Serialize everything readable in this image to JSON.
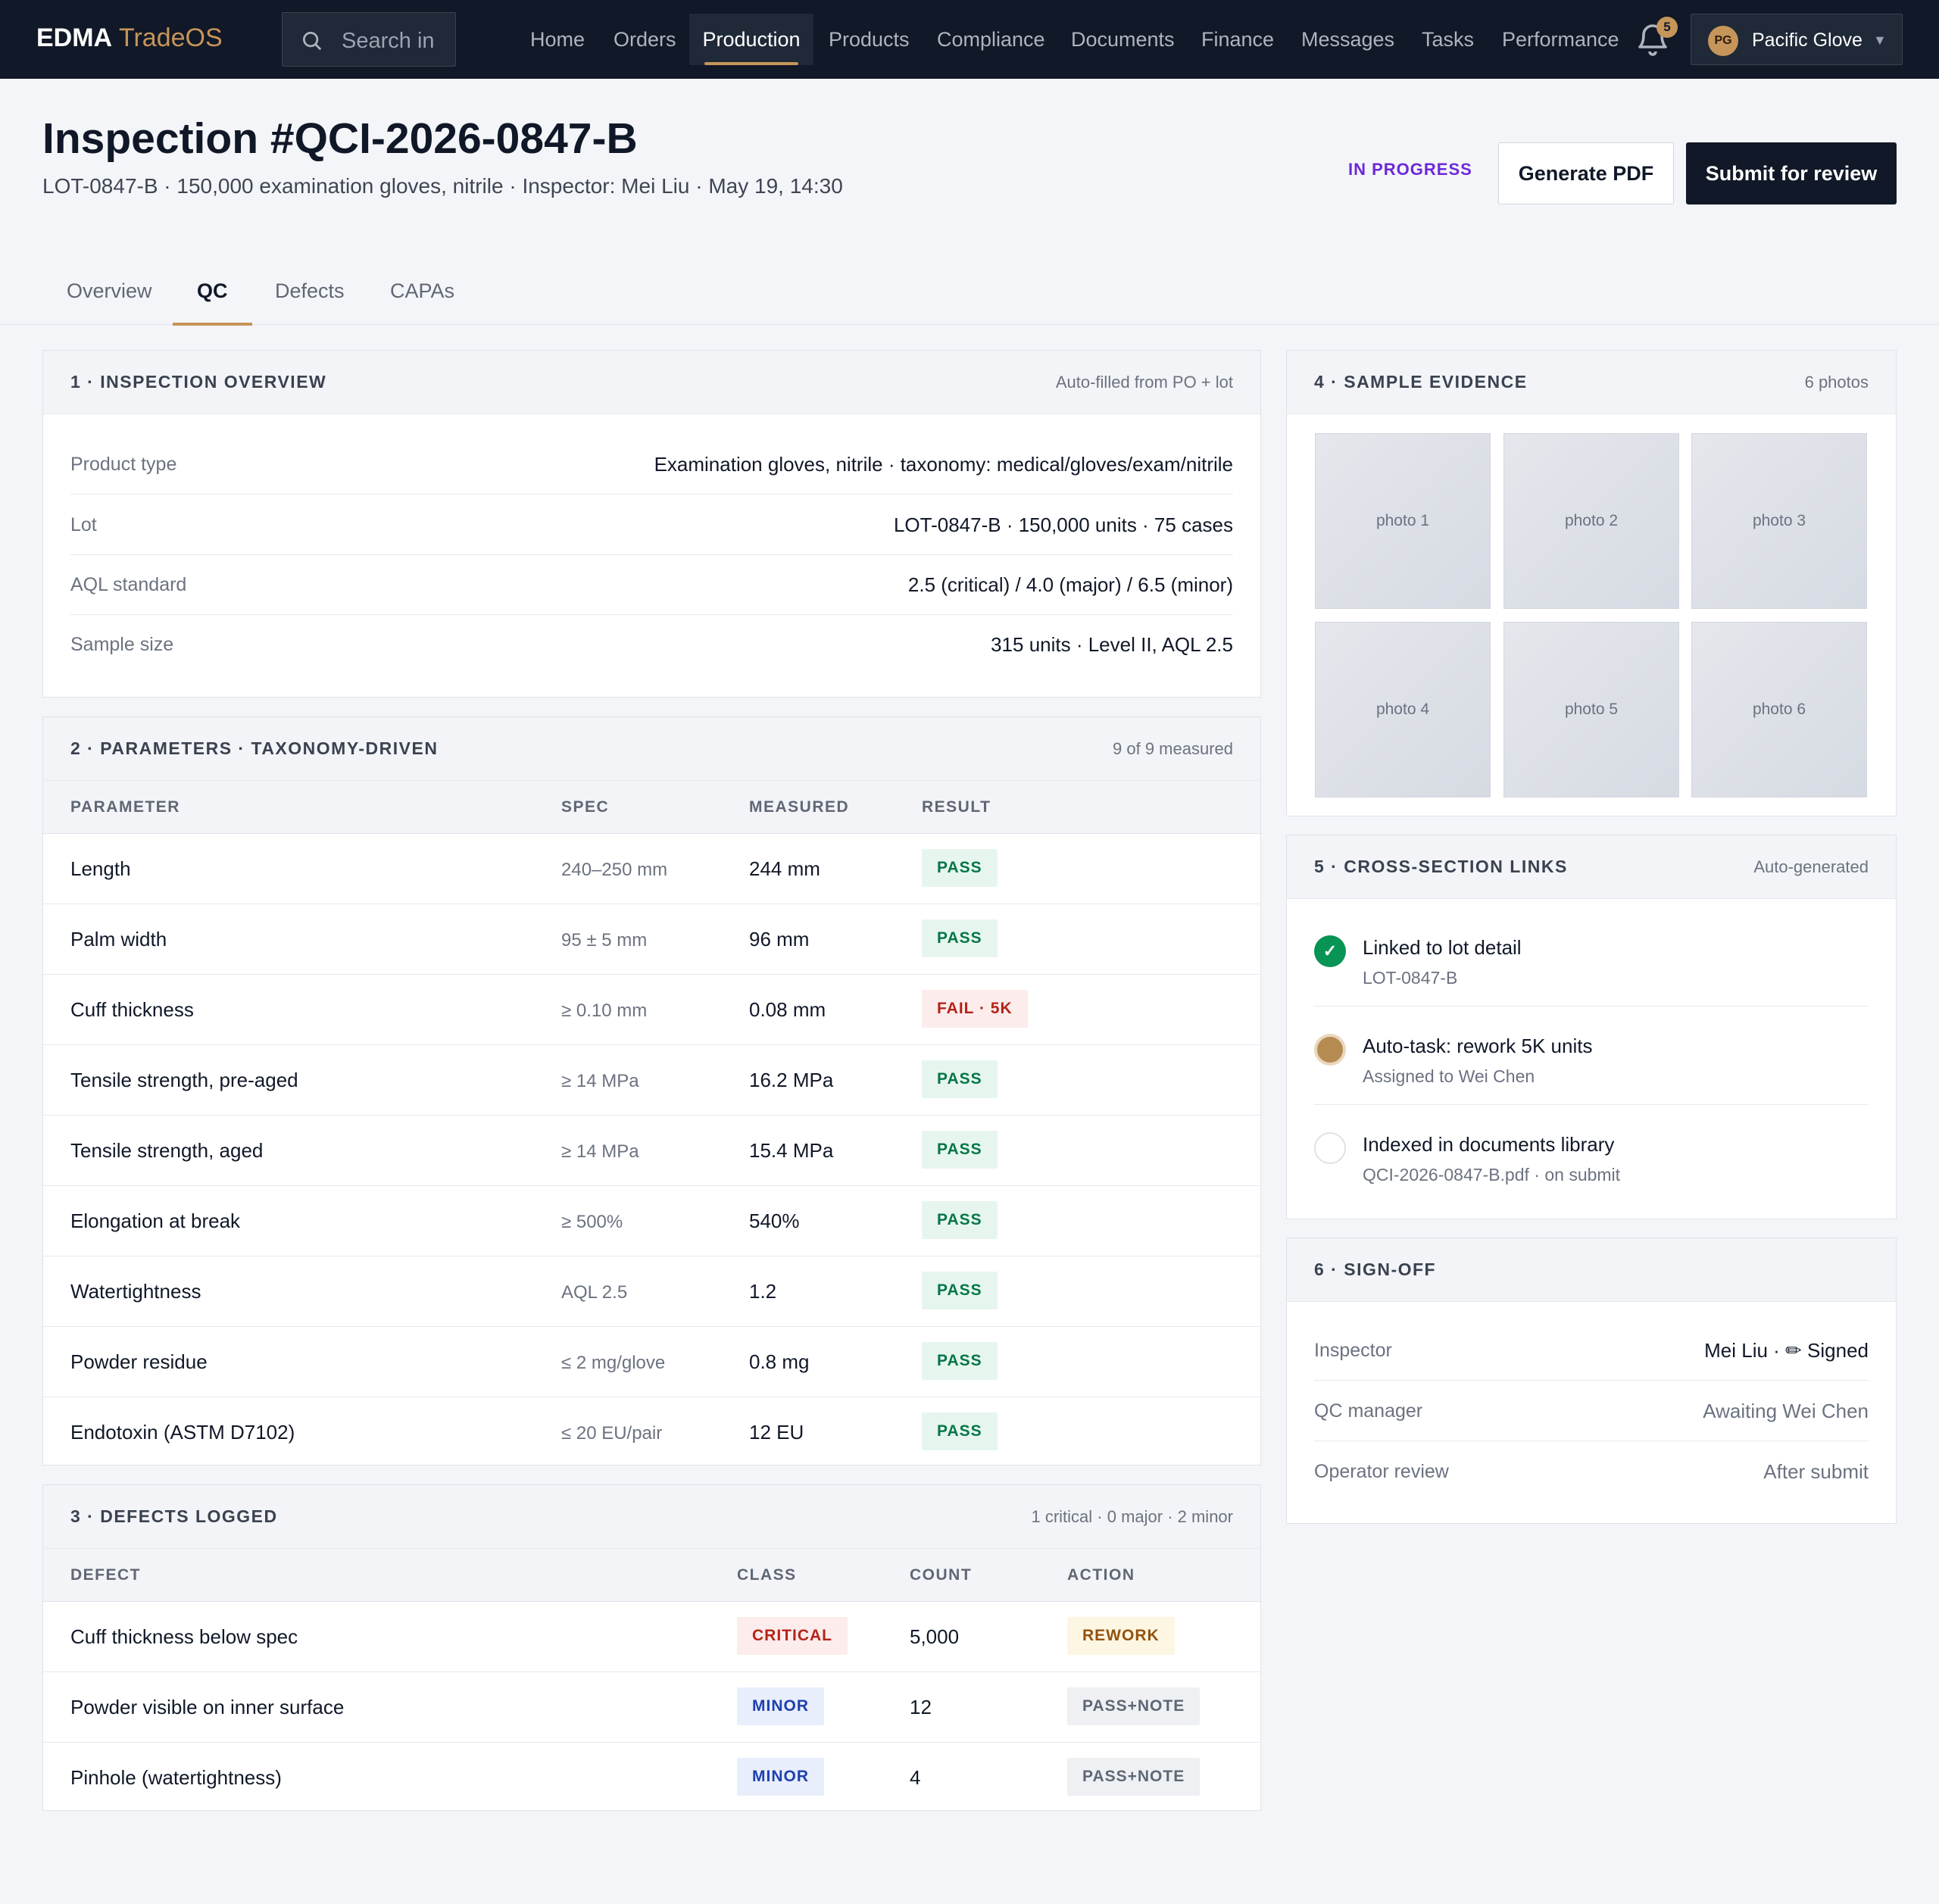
{
  "app": {
    "brand_primary": "EDMA",
    "brand_secondary": "TradeOS"
  },
  "search": {
    "placeholder": "Search in"
  },
  "nav": {
    "items": [
      "Home",
      "Orders",
      "Production",
      "Products",
      "Compliance",
      "Documents",
      "Finance",
      "Messages",
      "Tasks",
      "Performance"
    ],
    "active": "Production"
  },
  "notifications": {
    "count": "5",
    "icon": "bell-icon"
  },
  "account": {
    "initials": "PG",
    "name": "Pacific Glove"
  },
  "header": {
    "title": "Inspection #QCI-2026-0847-B",
    "subtitle": "LOT-0847-B · 150,000 examination gloves, nitrile · Inspector: Mei Liu · May 19, 14:30",
    "status": "IN PROGRESS",
    "generate_pdf": "Generate PDF",
    "submit": "Submit for review"
  },
  "tabs": [
    "Overview",
    "QC",
    "Defects",
    "CAPAs"
  ],
  "active_tab": "QC",
  "overview": {
    "title": "1 · INSPECTION OVERVIEW",
    "meta": "Auto-filled from PO + lot",
    "rows": [
      {
        "label": "Product type",
        "value": "Examination gloves, nitrile · taxonomy: medical/gloves/exam/nitrile"
      },
      {
        "label": "Lot",
        "value": "LOT-0847-B · 150,000 units · 75 cases"
      },
      {
        "label": "AQL standard",
        "value": "2.5 (critical) / 4.0 (major) / 6.5 (minor)"
      },
      {
        "label": "Sample size",
        "value": "315 units · Level II, AQL 2.5"
      }
    ]
  },
  "parameters": {
    "title": "2 · PARAMETERS · TAXONOMY-DRIVEN",
    "meta": "9 of 9 measured",
    "columns": [
      "PARAMETER",
      "SPEC",
      "MEASURED",
      "RESULT"
    ],
    "rows": [
      {
        "parameter": "Length",
        "spec": "240–250 mm",
        "measured": "244 mm",
        "result": "PASS"
      },
      {
        "parameter": "Palm width",
        "spec": "95 ± 5 mm",
        "measured": "96 mm",
        "result": "PASS"
      },
      {
        "parameter": "Cuff thickness",
        "spec": "≥ 0.10 mm",
        "measured": "0.08 mm",
        "result": "FAIL · 5K"
      },
      {
        "parameter": "Tensile strength, pre-aged",
        "spec": "≥ 14 MPa",
        "measured": "16.2 MPa",
        "result": "PASS"
      },
      {
        "parameter": "Tensile strength, aged",
        "spec": "≥ 14 MPa",
        "measured": "15.4 MPa",
        "result": "PASS"
      },
      {
        "parameter": "Elongation at break",
        "spec": "≥ 500%",
        "measured": "540%",
        "result": "PASS"
      },
      {
        "parameter": "Watertightness",
        "spec": "AQL 2.5",
        "measured": "1.2",
        "result": "PASS"
      },
      {
        "parameter": "Powder residue",
        "spec": "≤ 2 mg/glove",
        "measured": "0.8 mg",
        "result": "PASS"
      },
      {
        "parameter": "Endotoxin (ASTM D7102)",
        "spec": "≤ 20 EU/pair",
        "measured": "12 EU",
        "result": "PASS"
      }
    ]
  },
  "defects": {
    "title": "3 · DEFECTS LOGGED",
    "meta": "1 critical · 0 major · 2 minor",
    "columns": [
      "DEFECT",
      "CLASS",
      "COUNT",
      "ACTION"
    ],
    "rows": [
      {
        "defect": "Cuff thickness below spec",
        "class": "CRITICAL",
        "count": "5,000",
        "action": "REWORK"
      },
      {
        "defect": "Powder visible on inner surface",
        "class": "MINOR",
        "count": "12",
        "action": "PASS+NOTE"
      },
      {
        "defect": "Pinhole (watertightness)",
        "class": "MINOR",
        "count": "4",
        "action": "PASS+NOTE"
      }
    ]
  },
  "evidence": {
    "title": "4 · SAMPLE EVIDENCE",
    "meta": "6 photos",
    "photos": [
      "photo 1",
      "photo 2",
      "photo 3",
      "photo 4",
      "photo 5",
      "photo 6"
    ]
  },
  "links": {
    "title": "5 · CROSS-SECTION LINKS",
    "meta": "Auto-generated",
    "items": [
      {
        "title": "Linked to lot detail",
        "sub": "LOT-0847-B",
        "state": "done",
        "icon": "check-icon"
      },
      {
        "title": "Auto-task: rework 5K units",
        "sub": "Assigned to Wei Chen",
        "state": "task"
      },
      {
        "title": "Indexed in documents library",
        "sub": "QCI-2026-0847-B.pdf · on submit",
        "state": "pending"
      }
    ]
  },
  "signoff": {
    "title": "6 · SIGN-OFF",
    "rows": [
      {
        "label": "Inspector",
        "value": "Mei Liu · ✏ Signed"
      },
      {
        "label": "QC manager",
        "value": "Awaiting Wei Chen"
      },
      {
        "label": "Operator review",
        "value": "After submit"
      }
    ]
  },
  "colors": {
    "accent": "#c6955a",
    "navbar": "#111827",
    "pass": "#067647",
    "fail": "#b42318",
    "status": "#6d28d9"
  }
}
